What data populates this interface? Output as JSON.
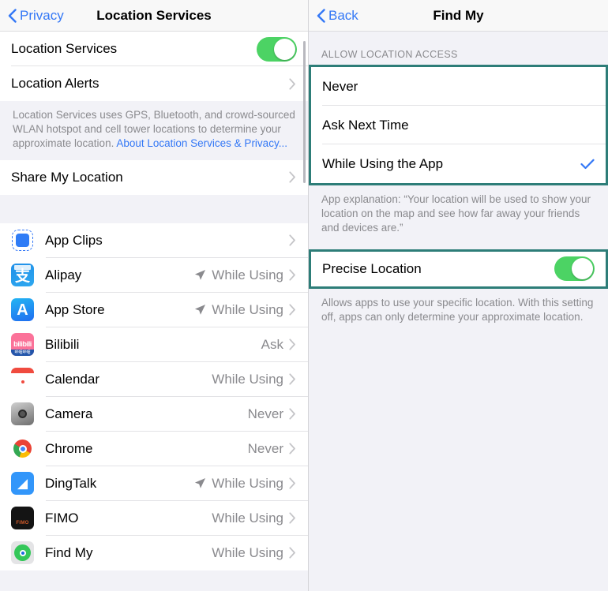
{
  "left": {
    "nav": {
      "back_label": "Privacy",
      "title": "Location Services",
      "back_icon": "chevron-left-icon"
    },
    "master_row": {
      "label": "Location Services",
      "toggle_on": true
    },
    "alerts_row": {
      "label": "Location Alerts",
      "chevron": "chevron-right-icon"
    },
    "footnote": {
      "text": "Location Services uses GPS, Bluetooth, and crowd-sourced WLAN hotspot and cell tower locations to determine your approximate location. ",
      "link": "About Location Services & Privacy..."
    },
    "share_row": {
      "label": "Share My Location",
      "chevron": "chevron-right-icon"
    },
    "apps": [
      {
        "name": "App Clips",
        "value": "",
        "arrow": false,
        "icon": "app-clips-icon"
      },
      {
        "name": "Alipay",
        "value": "While Using",
        "arrow": true,
        "icon": "alipay-icon"
      },
      {
        "name": "App Store",
        "value": "While Using",
        "arrow": true,
        "icon": "app-store-icon"
      },
      {
        "name": "Bilibili",
        "value": "Ask",
        "arrow": false,
        "icon": "bilibili-icon"
      },
      {
        "name": "Calendar",
        "value": "While Using",
        "arrow": false,
        "icon": "calendar-icon"
      },
      {
        "name": "Camera",
        "value": "Never",
        "arrow": false,
        "icon": "camera-icon"
      },
      {
        "name": "Chrome",
        "value": "Never",
        "arrow": false,
        "icon": "chrome-icon"
      },
      {
        "name": "DingTalk",
        "value": "While Using",
        "arrow": true,
        "icon": "dingtalk-icon"
      },
      {
        "name": "FIMO",
        "value": "While Using",
        "arrow": false,
        "icon": "fimo-icon"
      },
      {
        "name": "Find My",
        "value": "While Using",
        "arrow": false,
        "icon": "find-my-icon"
      }
    ]
  },
  "right": {
    "nav": {
      "back_label": "Back",
      "title": "Find My",
      "back_icon": "chevron-left-icon"
    },
    "section_header": "ALLOW LOCATION ACCESS",
    "options": [
      {
        "label": "Never",
        "selected": false
      },
      {
        "label": "Ask Next Time",
        "selected": false
      },
      {
        "label": "While Using the App",
        "selected": true
      }
    ],
    "explanation": "App explanation: “Your location will be used to show your location on the map and see how far away your friends and devices are.”",
    "precise": {
      "label": "Precise Location",
      "toggle_on": true
    },
    "precise_footnote": "Allows apps to use your specific location. With this setting off, apps can only determine your approximate location."
  },
  "colors": {
    "accent_blue": "#3478f6",
    "toggle_green": "#4cd364",
    "highlight_teal": "#2d7d78",
    "group_bg": "#f2f2f7",
    "secondary_text": "#8a8a8e"
  }
}
